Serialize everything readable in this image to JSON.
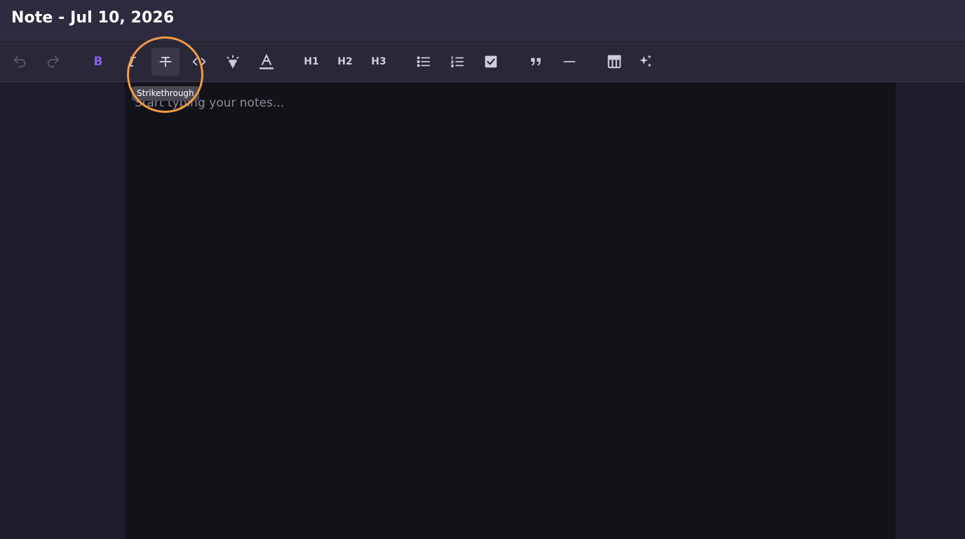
{
  "window": {
    "title": "Note - Jul 10, 2026"
  },
  "toolbar": {
    "bold_label": "B",
    "h1_label": "H1",
    "h2_label": "H2",
    "h3_label": "H3",
    "active_button": "strikethrough",
    "tooltip": "Strikethrough",
    "icons": [
      "undo-icon",
      "redo-icon",
      "bold-icon",
      "italic-icon",
      "strikethrough-icon",
      "code-icon",
      "highlight-icon",
      "text-color-icon",
      "heading-1",
      "heading-2",
      "heading-3",
      "bullet-list-icon",
      "ordered-list-icon",
      "checklist-icon",
      "quote-icon",
      "horizontal-rule-icon",
      "table-icon",
      "ai-sparkle-icon"
    ]
  },
  "editor": {
    "placeholder": "Start typing your notes..."
  },
  "colors": {
    "accent": "#8b5cf6",
    "highlight_ring": "#f59a43",
    "titlebar_bg": "#2e2b40",
    "editor_bg": "#131219"
  }
}
